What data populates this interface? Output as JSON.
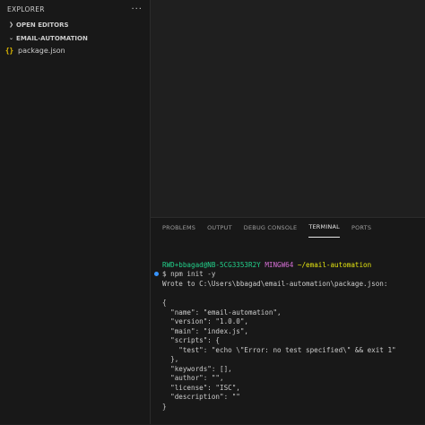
{
  "sidebar": {
    "title": "EXPLORER",
    "more_icon": "···",
    "sections": {
      "open_editors": "OPEN EDITORS",
      "project": "EMAIL-AUTOMATION"
    },
    "files": [
      {
        "icon": "{}",
        "name": "package.json"
      }
    ]
  },
  "panel": {
    "tabs": [
      "PROBLEMS",
      "OUTPUT",
      "DEBUG CONSOLE",
      "TERMINAL",
      "PORTS"
    ],
    "active_tab": "TERMINAL"
  },
  "terminal": {
    "prompt_user": "RWD+bbagad@NB-5CG3353R2Y",
    "prompt_env": "MINGW64",
    "prompt_path": "~/email-automation",
    "command": "$ npm init -y",
    "output": [
      "Wrote to C:\\Users\\bbagad\\email-automation\\package.json:",
      "",
      "{",
      "  \"name\": \"email-automation\",",
      "  \"version\": \"1.0.0\",",
      "  \"main\": \"index.js\",",
      "  \"scripts\": {",
      "    \"test\": \"echo \\\"Error: no test specified\\\" && exit 1\"",
      "  },",
      "  \"keywords\": [],",
      "  \"author\": \"\",",
      "  \"license\": \"ISC\",",
      "  \"description\": \"\"",
      "}"
    ]
  },
  "colors": {
    "prompt_user": "#23d18b",
    "prompt_env": "#d670d6",
    "prompt_path": "#e5e510",
    "command_marker": "#3794ff"
  }
}
